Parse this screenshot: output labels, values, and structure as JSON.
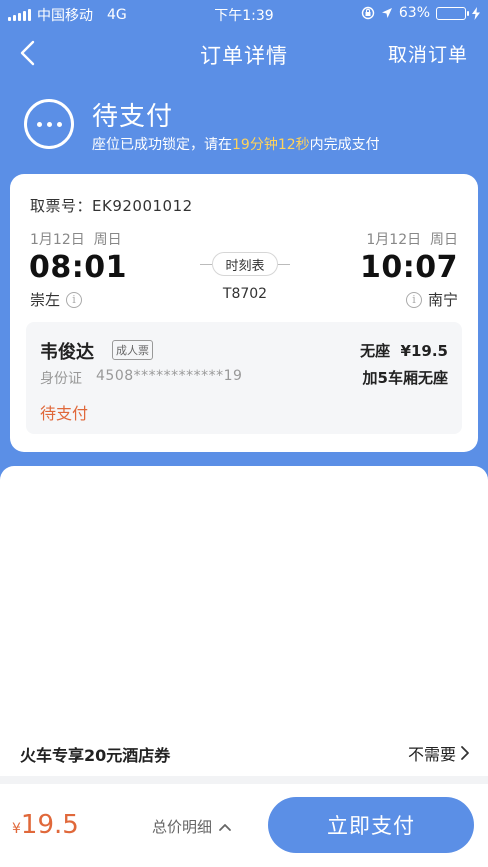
{
  "status_bar": {
    "carrier": "中国移动",
    "network": "4G",
    "time": "下午1:39",
    "battery": "63%"
  },
  "nav": {
    "title": "订单详情",
    "cancel_label": "取消订单"
  },
  "order_status": {
    "title": "待支付",
    "sub_prefix": "座位已成功锁定，请在",
    "sub_countdown": "19分钟12秒",
    "sub_suffix": "内完成支付"
  },
  "ticket": {
    "pickup_label": "取票号：",
    "pickup_code": "EK92001012",
    "departure": {
      "date": "1月12日  周日",
      "time": "08:01",
      "station": "崇左"
    },
    "arrival": {
      "date": "1月12日  周日",
      "time": "10:07",
      "station": "南宁"
    },
    "schedule_label": "时刻表",
    "train_number": "T8702"
  },
  "passenger": {
    "name": "韦俊达",
    "ticket_type": "成人票",
    "seat": "无座  ¥19.5",
    "id_label": "身份证",
    "id_number": "4508************19",
    "car": "加5车厢无座",
    "status": "待支付"
  },
  "coupon": {
    "title": "火车专享20元酒店券",
    "action": "不需要"
  },
  "bottom": {
    "currency": "¥",
    "amount": "19.5",
    "detail_label": "总价明细",
    "pay_label": "立即支付"
  },
  "colors": {
    "brand_blue": "#5b8fe6",
    "accent_orange": "#e0683a",
    "highlight_yellow": "#ffd35b"
  }
}
